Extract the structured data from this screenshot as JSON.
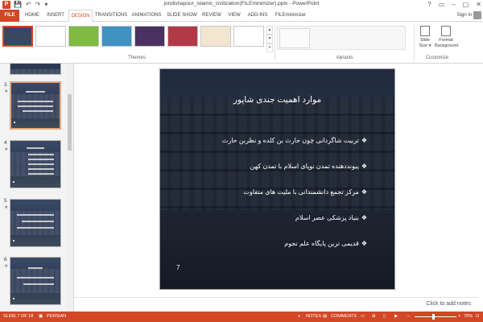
{
  "app": {
    "logo": "P",
    "title": "jondishapour_islamic_civilization(FILEminimizer).pptx - PowerPoint",
    "sign_in": "Sign in",
    "window_controls": [
      "?",
      "▭",
      "–",
      "▢",
      "✕"
    ],
    "quick_access": [
      "💾",
      "↶",
      "↷",
      "▾"
    ]
  },
  "tabs": [
    "FILE",
    "HOME",
    "INSERT",
    "DESIGN",
    "TRANSITIONS",
    "ANIMATIONS",
    "SLIDE SHOW",
    "REVIEW",
    "VIEW",
    "ADD-INS",
    "FILEminimizer"
  ],
  "active_tab": "DESIGN",
  "ribbon": {
    "themes_label": "Themes",
    "variants_label": "Variants",
    "customize_label": "Customize",
    "theme_colors": [
      "#3a4564",
      "#ffffff",
      "#7fba42",
      "#3f92c2",
      "#4a3260",
      "#b23a48",
      "#f2e6d0",
      "#ffffff"
    ],
    "slide_size": "Slide Size ▾",
    "format_background": "Format Background"
  },
  "left_pane": {
    "slides": [
      {
        "num": "3",
        "star": "★"
      },
      {
        "num": "4",
        "star": "★"
      },
      {
        "num": "5",
        "star": "★"
      },
      {
        "num": "6",
        "star": "★"
      }
    ]
  },
  "slide": {
    "title": "موارد اهمیت جندی شاپور",
    "bullets": [
      "تربیت شاگردانی چون حارث بن کلده و نظربن حارث",
      "پیونددهنده تمدن نوپای اسلام با تمدن کهن",
      "مرکز تجمع دانشمندانی با ملیت های متفاوت",
      "بنیاد پزشکی عصر اسلام",
      "قدیمی ترین پایگاه علم نجوم"
    ],
    "bullet_marker": "❖",
    "page_number": "7"
  },
  "notes_placeholder": "Click to add notes",
  "status": {
    "slide_info": "SLIDE 7 OF 18",
    "language": "PERSIAN",
    "notes": "NOTES",
    "comments": "COMMENTS",
    "zoom": "70%"
  }
}
